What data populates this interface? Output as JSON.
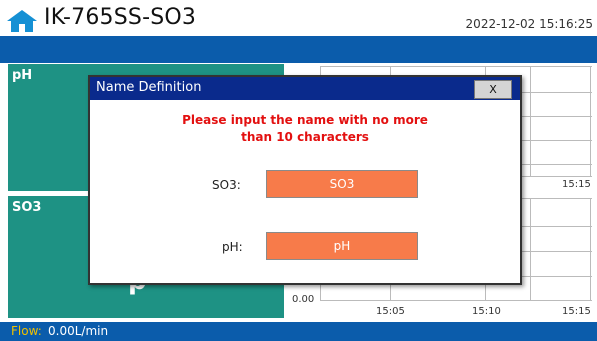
{
  "header": {
    "title": "IK-765SS-SO3",
    "datetime": "2022-12-02 15:16:25",
    "home_icon": "home-icon"
  },
  "panels": [
    {
      "label": "pH"
    },
    {
      "label": "SO3",
      "value": "p"
    }
  ],
  "charts": {
    "top": {
      "x_tick": "15:15"
    },
    "bottom": {
      "y_tick": "0.00",
      "x_ticks": [
        "15:05",
        "15:10",
        "15:15"
      ]
    }
  },
  "footer": {
    "flow_label": "Flow:",
    "flow_value": "0.00L/min"
  },
  "dialog": {
    "title": "Name Definition",
    "close_label": "X",
    "message_line1": "Please input the name with no more",
    "message_line2": "than 10 characters",
    "fields": [
      {
        "label": "SO3:",
        "value": "SO3"
      },
      {
        "label": "pH:",
        "value": "pH"
      }
    ]
  },
  "colors": {
    "accent": "#0b5cab",
    "panel": "#1e9284",
    "dialog_title": "#0a2a8c",
    "warn": "#e31010",
    "field": "#f77b4a"
  }
}
